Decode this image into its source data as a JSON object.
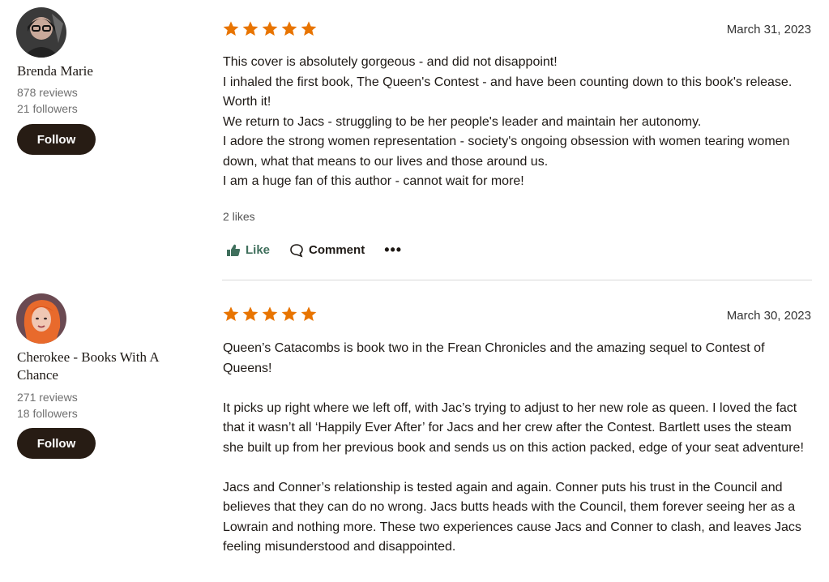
{
  "reviews": [
    {
      "user": {
        "name": "Brenda Marie",
        "reviews_count": "878 reviews",
        "followers_count": "21 followers",
        "follow_label": "Follow"
      },
      "rating": 5,
      "date": "March 31, 2023",
      "paragraphs": [
        "This cover is absolutely gorgeous - and did not disappoint!\nI inhaled the first book, The Queen's Contest - and have been counting down to this book's release. Worth it!\nWe return to Jacs - struggling to be her people's leader and maintain her autonomy.\nI adore the strong women representation - society's ongoing obsession with women tearing women down, what that means to our lives and those around us.\nI am a huge fan of this author - cannot wait for more!"
      ],
      "likes": "2 likes",
      "actions": {
        "like": "Like",
        "comment": "Comment",
        "more": "•••"
      }
    },
    {
      "user": {
        "name": "Cherokee - Books With A Chance",
        "reviews_count": "271 reviews",
        "followers_count": "18 followers",
        "follow_label": "Follow"
      },
      "rating": 5,
      "date": "March 30, 2023",
      "paragraphs": [
        "Queen’s Catacombs is book two in the Frean Chronicles and the amazing sequel to Contest of Queens!",
        "It picks up right where we left off, with Jac’s trying to adjust to her new role as queen. I loved the fact that it wasn’t all ‘Happily Ever After’ for Jacs and her crew after the Contest. Bartlett uses the steam she built up from her previous book and sends us on this action packed, edge of your seat adventure!",
        "Jacs and Conner’s relationship is tested again and again. Conner puts his trust in the Council and believes that they can do no wrong. Jacs butts heads with the Council, them forever seeing her as a Lowrain and nothing more. These two experiences cause Jacs and Conner to clash, and leaves Jacs feeling misunderstood and disappointed."
      ]
    }
  ],
  "icons": {
    "star": "star-icon",
    "like": "thumbs-up-icon",
    "comment": "comment-bubble-icon",
    "more": "more-dots-icon"
  },
  "colors": {
    "star": "#e87400",
    "follow_bg": "#271c14",
    "like": "#3f6f5c"
  }
}
